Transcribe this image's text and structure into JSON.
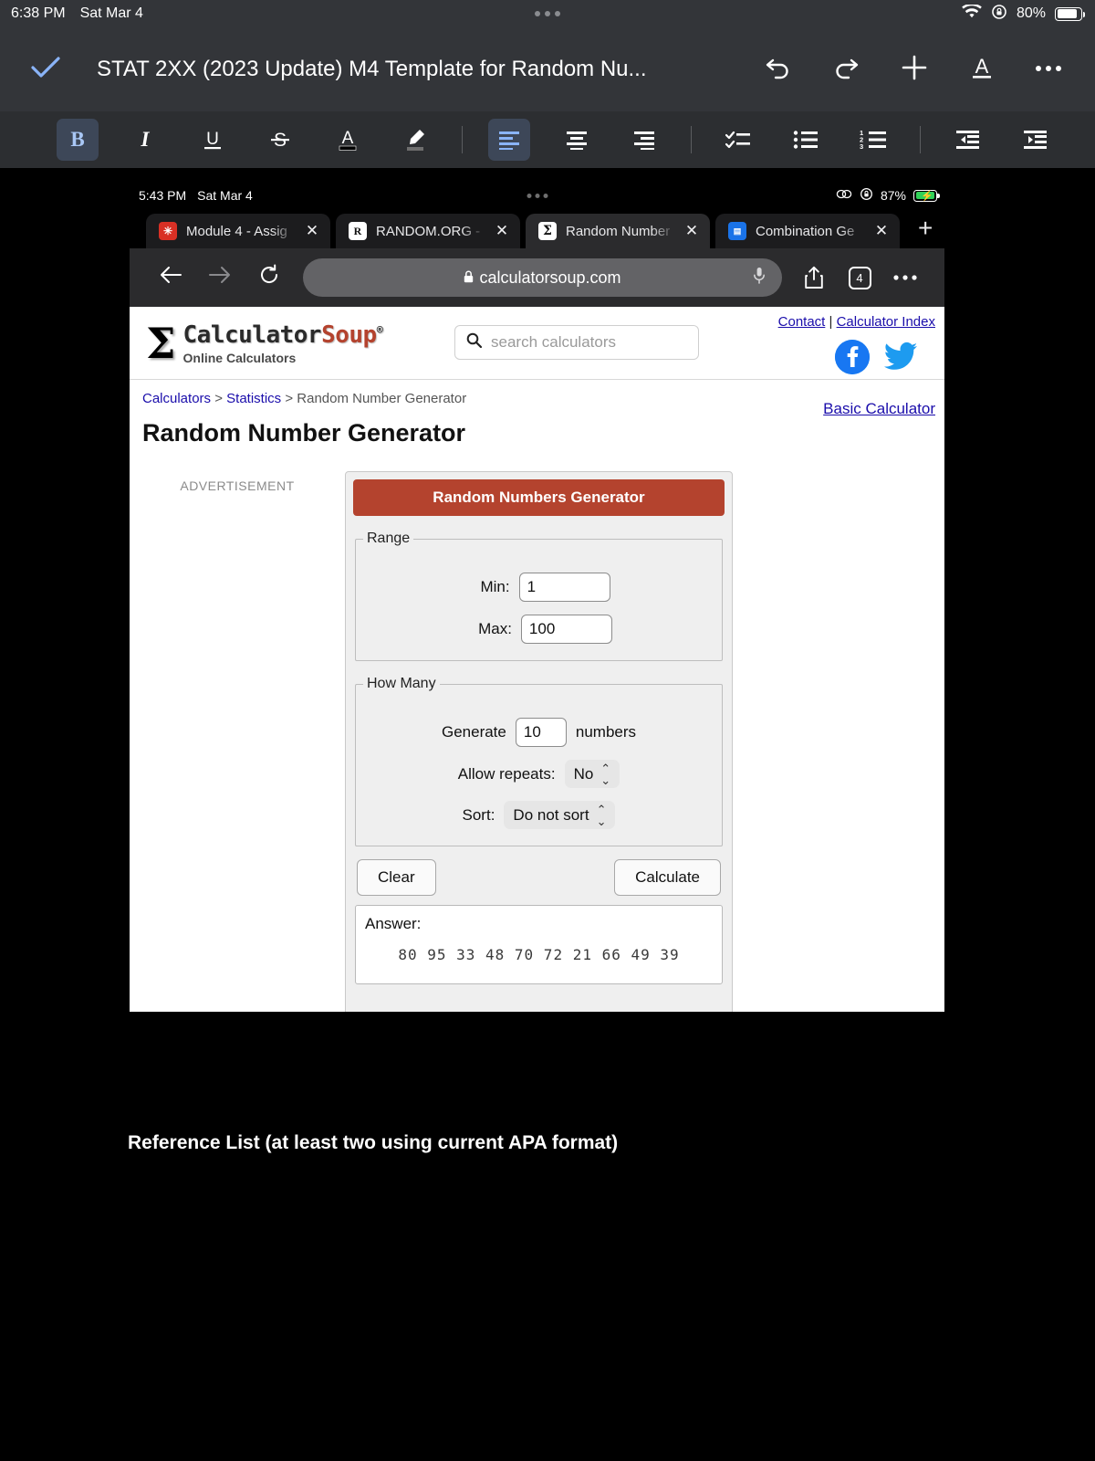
{
  "os_statusbar": {
    "time": "6:38 PM",
    "date": "Sat Mar 4",
    "battery_percent": "80%",
    "wifi_icon": "wifi-icon",
    "orientation_lock_icon": "rotation-lock-icon"
  },
  "docs": {
    "done_icon": "checkmark-icon",
    "title": "STAT 2XX (2023 Update) M4 Template for Random Nu...",
    "actions": [
      {
        "name": "undo-button",
        "glyph": "undo-icon"
      },
      {
        "name": "redo-button",
        "glyph": "redo-icon"
      },
      {
        "name": "insert-button",
        "glyph": "plus-icon"
      },
      {
        "name": "text-format-button",
        "glyph": "format-a-icon"
      },
      {
        "name": "more-options-button",
        "glyph": "ellipsis-icon"
      }
    ],
    "toolbar": [
      {
        "name": "bold-button",
        "label": "B",
        "active": true
      },
      {
        "name": "italic-button",
        "label": "I",
        "active": false
      },
      {
        "name": "underline-button",
        "label": "U",
        "active": false
      },
      {
        "name": "strikethrough-button",
        "label": "S",
        "active": false
      },
      {
        "name": "text-color-button",
        "label": "A",
        "active": false
      },
      {
        "name": "highlight-button",
        "label": "pen",
        "active": false
      },
      {
        "name": "align-left-button",
        "label": "align-left",
        "active": true
      },
      {
        "name": "align-center-button",
        "label": "align-center",
        "active": false
      },
      {
        "name": "align-right-button",
        "label": "align-right",
        "active": false
      },
      {
        "name": "checklist-button",
        "label": "checklist",
        "active": false
      },
      {
        "name": "bulleted-list-button",
        "label": "bullets",
        "active": false
      },
      {
        "name": "numbered-list-button",
        "label": "numbers",
        "active": false
      },
      {
        "name": "decrease-indent-button",
        "label": "outdent",
        "active": false
      },
      {
        "name": "increase-indent-button",
        "label": "indent",
        "active": false
      }
    ]
  },
  "screenshot": {
    "statusbar": {
      "time": "5:43 PM",
      "date": "Sat Mar 4",
      "battery_percent": "87%",
      "link_icon": "chain-link-icon",
      "orientation_lock_icon": "rotation-lock-icon",
      "charging": true
    },
    "tabs": [
      {
        "label": "Module 4 - Assig",
        "favicon": "canvas-icon",
        "favicon_bg": "#d93025",
        "favicon_glyph": "✹",
        "active": false
      },
      {
        "label": "RANDOM.ORG -",
        "favicon": "random-org-icon",
        "favicon_bg": "#ffffff",
        "favicon_glyph": "R",
        "active": false
      },
      {
        "label": "Random Number",
        "favicon": "sigma-icon",
        "favicon_bg": "#ffffff",
        "favicon_glyph": "Σ",
        "active": true
      },
      {
        "label": "Combination Ge",
        "favicon": "calculator-icon",
        "favicon_bg": "#1a73e8",
        "favicon_glyph": "≡",
        "active": false
      }
    ],
    "new_tab_label": "+",
    "browser": {
      "back_icon": "back-arrow-icon",
      "forward_icon": "forward-arrow-icon",
      "reload_icon": "reload-icon",
      "lock_icon": "lock-icon",
      "url": "calculatorsoup.com",
      "mic_icon": "microphone-icon",
      "share_icon": "share-icon",
      "tab_count": "4",
      "more_icon": "ellipsis-icon"
    },
    "site": {
      "logo_sigma": "Σ",
      "logo_text_1": "Calculator",
      "logo_text_2": "Soup",
      "logo_reg": "®",
      "logo_tagline": "Online Calculators",
      "search_placeholder": "search calculators",
      "search_icon": "search-icon",
      "contact_link": "Contact",
      "separator": "|",
      "index_link": "Calculator Index",
      "facebook_icon": "facebook-icon",
      "twitter_icon": "twitter-icon",
      "breadcrumb": [
        {
          "label": "Calculators",
          "link": true
        },
        {
          "label": ">",
          "link": false
        },
        {
          "label": "Statistics",
          "link": true
        },
        {
          "label": ">",
          "link": false
        },
        {
          "label": "Random Number Generator",
          "link": false
        }
      ],
      "basic_calculator_link": "Basic Calculator",
      "page_title": "Random Number Generator",
      "advertisement_label": "ADVERTISEMENT",
      "accent_color": "#b4432e",
      "link_color": "#1a0dab"
    },
    "calculator": {
      "title": "Random Numbers Generator",
      "range_legend": "Range",
      "min_label": "Min:",
      "min_value": "1",
      "max_label": "Max:",
      "max_value": "100",
      "howmany_legend": "How Many",
      "generate_label": "Generate",
      "generate_value": "10",
      "numbers_label": "numbers",
      "allow_repeats_label": "Allow repeats:",
      "allow_repeats_value": "No",
      "sort_label": "Sort:",
      "sort_value": "Do not sort",
      "clear_button": "Clear",
      "calculate_button": "Calculate",
      "answer_label": "Answer:",
      "answer_values": "80  95  33  48  70  72  21  66  49  39"
    }
  },
  "document": {
    "reference_heading": "Reference List (at least two using current APA format)"
  }
}
